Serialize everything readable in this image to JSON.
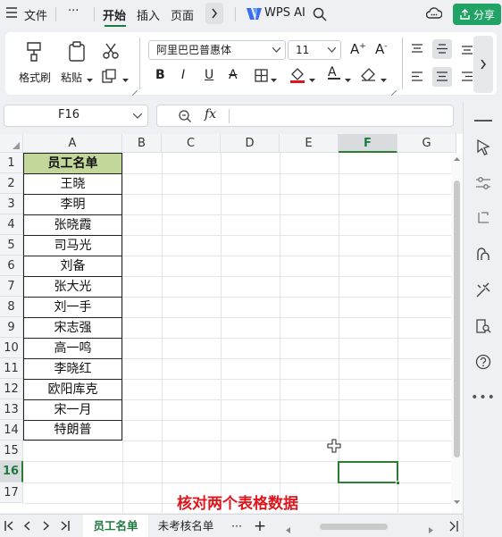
{
  "menu": {
    "file": "文件",
    "more": "···",
    "start": "开始",
    "insert": "插入",
    "page": "页面",
    "wps_ai": "WPS AI",
    "share": "分享"
  },
  "ribbon": {
    "format_painter": "格式刷",
    "paste": "粘贴",
    "font_name": "阿里巴巴普惠体",
    "font_size": "11"
  },
  "formula_bar": {
    "cell_ref": "F16",
    "fx_label": "fx",
    "content": ""
  },
  "columns": [
    "A",
    "B",
    "C",
    "D",
    "E",
    "F",
    "G"
  ],
  "rows": [
    "1",
    "2",
    "3",
    "4",
    "5",
    "6",
    "7",
    "8",
    "9",
    "10",
    "11",
    "12",
    "13",
    "14",
    "15",
    "16",
    "17"
  ],
  "table": {
    "header": "员工名单",
    "names": [
      "王晓",
      "李明",
      "张晓霞",
      "司马光",
      "刘备",
      "张大光",
      "刘一手",
      "宋志强",
      "高一鸣",
      "李晓红",
      "欧阳库克",
      "宋一月",
      "特朗普"
    ]
  },
  "caption": "核对两个表格数据",
  "sheet_tabs": {
    "tab1": "员工名单",
    "tab2": "未考核名单",
    "more": "···",
    "add": "+"
  },
  "accent_color": "#1f7a3f",
  "caption_color": "#e0161d",
  "header_fill": "#c4d79b"
}
